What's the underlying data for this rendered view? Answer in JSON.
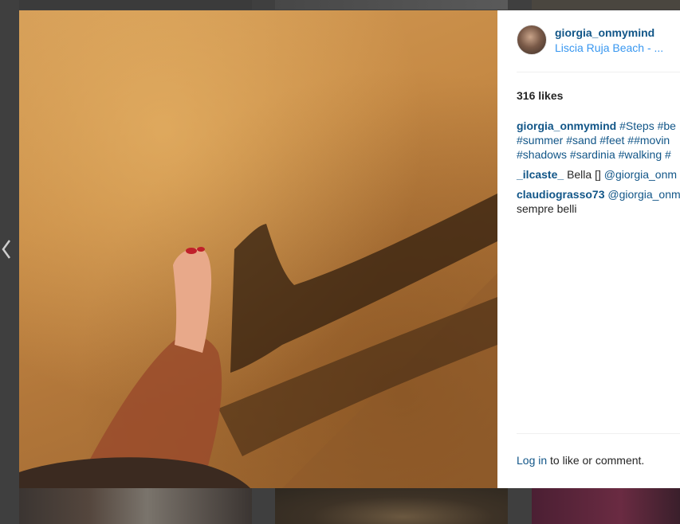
{
  "post": {
    "username": "giorgia_onmymind",
    "location": "Liscia Ruja Beach - ...",
    "likes": "316 likes",
    "photo_icon": "beach-photo"
  },
  "comments": [
    {
      "user": "giorgia_onmymind",
      "lines": [
        "#Steps #be",
        "#summer #sand #feet ##movin",
        "#shadows #sardinia #walking #"
      ]
    },
    {
      "user": "_ilcaste_",
      "text": "Bella []",
      "mention": "@giorgia_onm"
    },
    {
      "user": "claudiograsso73",
      "mention": "@giorgia_onm",
      "text2": "sempre belli"
    }
  ],
  "footer": {
    "login_link": "Log in",
    "login_rest": "to like or comment."
  },
  "nav": {
    "prev_icon": "chevron-left-icon"
  },
  "colors": {
    "username": "#125688",
    "location": "#3897f0",
    "overlay": "#3f3f3f"
  }
}
